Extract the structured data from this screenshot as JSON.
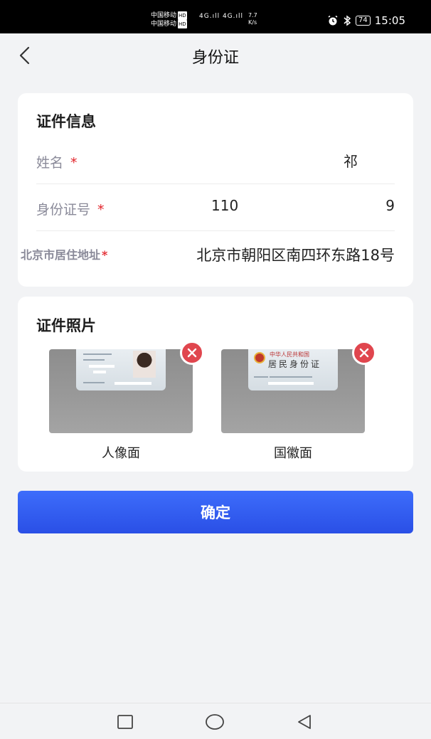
{
  "status_bar": {
    "carrier_1": "中国移动",
    "carrier_2": "中国移动",
    "hd_badge": "HD",
    "network_1": "4G",
    "network_2": "4G",
    "speed_value": "7.7",
    "speed_unit": "K/s",
    "battery": "74",
    "time": "15:05",
    "icons": [
      "alarm-icon",
      "bluetooth-icon",
      "battery-icon"
    ]
  },
  "header": {
    "title": "身份证",
    "back_icon": "chevron-left-icon"
  },
  "info_card": {
    "title": "证件信息",
    "name": {
      "label": "姓名",
      "required_mark": "*",
      "value": "祁"
    },
    "id_number": {
      "label": "身份证号",
      "required_mark": "*",
      "value_start": "110",
      "value_end": "9"
    },
    "address": {
      "label": "北京市居住地址",
      "required_mark": "*",
      "value": "北京市朝阳区南四环东路18号"
    }
  },
  "photo_card": {
    "title": "证件照片",
    "photos": [
      {
        "caption": "人像面",
        "remove_icon": "close-icon"
      },
      {
        "caption": "国徽面",
        "remove_icon": "close-icon",
        "card_header": "中华人民共和国",
        "card_title": "居民身份证"
      }
    ]
  },
  "confirm_button": {
    "label": "确定"
  },
  "nav_bar": {
    "icons": [
      "recent-apps-icon",
      "home-icon",
      "back-icon"
    ]
  },
  "colors": {
    "accent": "#2f5bf0",
    "required": "#e2232a",
    "remove": "#e0464e",
    "background": "#f2f3f5"
  }
}
